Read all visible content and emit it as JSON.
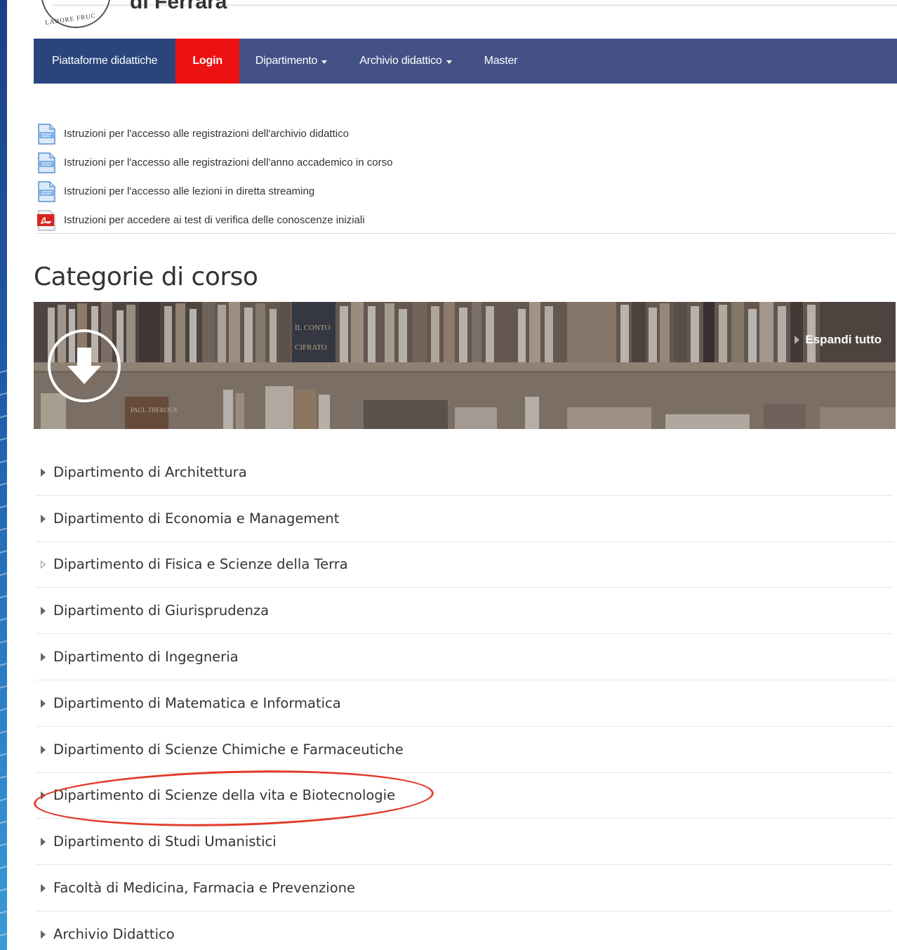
{
  "header": {
    "site_name": "di Ferrara",
    "seal_text": "LABORE FRUC"
  },
  "navbar": {
    "items": [
      {
        "label": "Piattaforme didattiche"
      },
      {
        "label": "Login"
      },
      {
        "label": "Dipartimento"
      },
      {
        "label": "Archivio didattico"
      },
      {
        "label": "Master"
      }
    ]
  },
  "documents": [
    {
      "label": "Istruzioni per l'accesso alle registrazioni dell'archivio didattico",
      "icon": "document-icon"
    },
    {
      "label": "Istruzioni per l'accesso alle registrazioni dell'anno accademico in corso",
      "icon": "document-icon"
    },
    {
      "label": "Istruzioni per l'accesso alle lezioni in diretta streaming",
      "icon": "document-icon"
    },
    {
      "label": "Istruzioni per accedere ai test di verifica delle conoscenze iniziali",
      "icon": "pdf-icon"
    }
  ],
  "page_title": "Categorie di corso",
  "banner": {
    "expand_label": "Espandi tutto",
    "book_text_1": "IL CONTO",
    "book_text_2": "CIFRATO",
    "book_text_3": "PAUL THEROUX"
  },
  "categories": [
    {
      "label": "Dipartimento di Architettura"
    },
    {
      "label": "Dipartimento di Economia e Management"
    },
    {
      "label": "Dipartimento di Fisica e Scienze della Terra"
    },
    {
      "label": "Dipartimento di Giurisprudenza"
    },
    {
      "label": "Dipartimento di Ingegneria"
    },
    {
      "label": "Dipartimento di Matematica e Informatica"
    },
    {
      "label": "Dipartimento di Scienze Chimiche e Farmaceutiche"
    },
    {
      "label": "Dipartimento di Scienze della vita e Biotecnologie"
    },
    {
      "label": "Dipartimento di Studi Umanistici"
    },
    {
      "label": "Facoltà di Medicina, Farmacia e Prevenzione"
    },
    {
      "label": "Archivio Didattico"
    }
  ],
  "colors": {
    "navbar": "#445187",
    "navbar_first": "#29457c",
    "login": "#ee1111",
    "annotation": "#e23a2a"
  }
}
